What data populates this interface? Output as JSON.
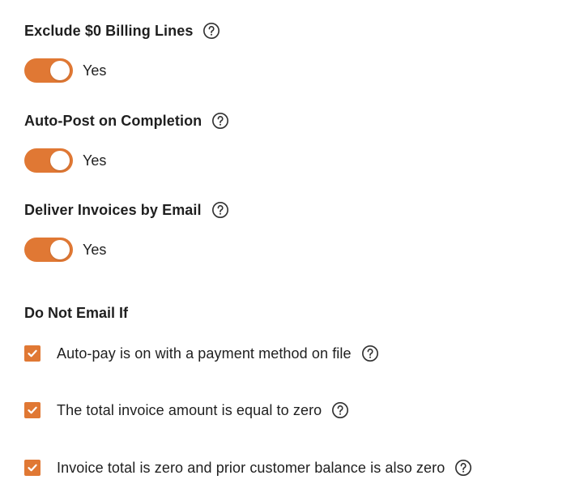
{
  "settings": [
    {
      "title": "Exclude $0 Billing Lines",
      "toggle_label": "Yes",
      "on": true
    },
    {
      "title": "Auto-Post on Completion",
      "toggle_label": "Yes",
      "on": true
    },
    {
      "title": "Deliver Invoices by Email",
      "toggle_label": "Yes",
      "on": true
    }
  ],
  "do_not_email": {
    "title": "Do Not Email If",
    "options": [
      {
        "label": "Auto-pay is on with a payment method on file",
        "checked": true
      },
      {
        "label": "The total invoice amount is equal to zero",
        "checked": true
      },
      {
        "label": "Invoice total is zero and prior customer balance is also zero",
        "checked": true
      }
    ]
  },
  "colors": {
    "accent": "#e07834",
    "text": "#1f1f1f",
    "help_icon": "#333333"
  },
  "icons": {
    "help": "question-circle-icon",
    "check": "checkmark-icon"
  }
}
